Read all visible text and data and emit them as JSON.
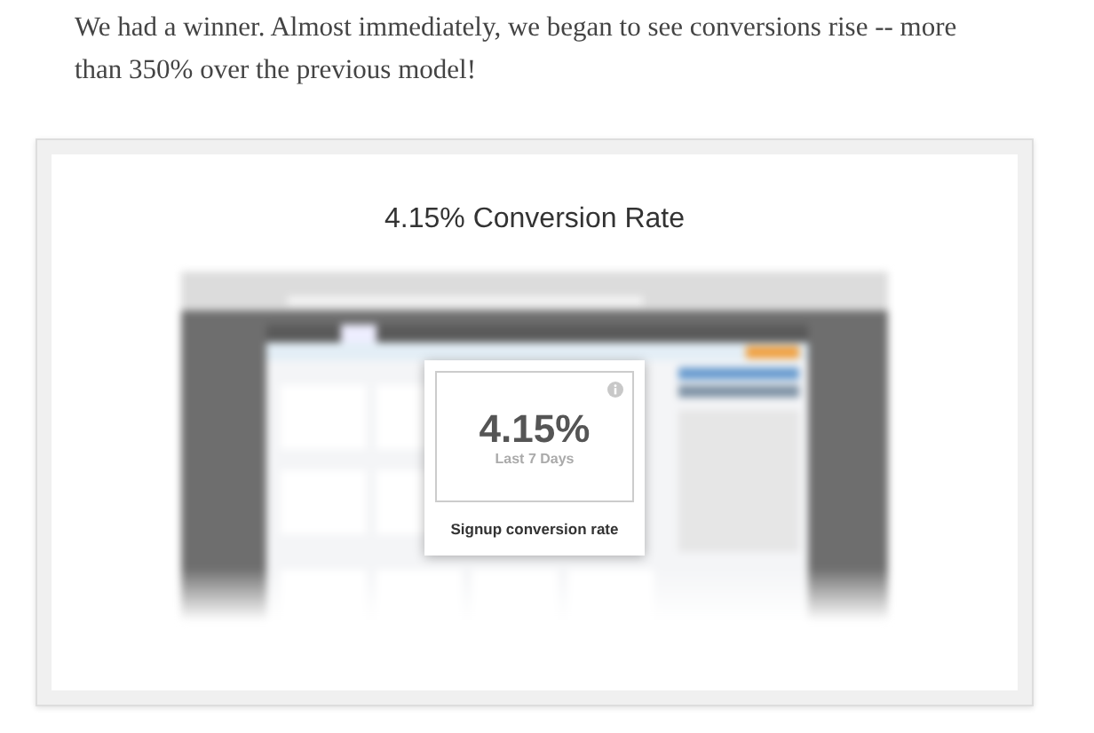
{
  "paragraph": "We had a winner. Almost immediately, we began to see conversions rise -- more than 350% over the previous model!",
  "figure": {
    "title": "4.15% Conversion Rate",
    "popup": {
      "value": "4.15%",
      "period": "Last 7 Days",
      "label": "Signup conversion rate"
    }
  }
}
